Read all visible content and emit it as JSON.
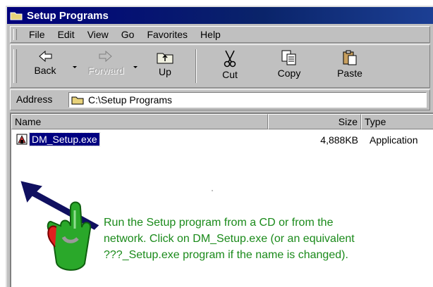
{
  "window": {
    "title": "Setup Programs",
    "title_icon": "folder-icon"
  },
  "menu": [
    {
      "label": "File"
    },
    {
      "label": "Edit"
    },
    {
      "label": "View"
    },
    {
      "label": "Go"
    },
    {
      "label": "Favorites"
    },
    {
      "label": "Help"
    }
  ],
  "toolbar": {
    "back": "Back",
    "forward": "Forward",
    "up": "Up",
    "cut": "Cut",
    "copy": "Copy",
    "paste": "Paste"
  },
  "address": {
    "label": "Address",
    "value": "C:\\Setup Programs"
  },
  "columns": {
    "name": "Name",
    "size": "Size",
    "type": "Type"
  },
  "files": [
    {
      "name": "DM_Setup.exe",
      "size": "4,888KB",
      "type": "Application"
    }
  ],
  "callout": {
    "line1": "Run the Setup program from a CD or from the",
    "line2": "network. Click on DM_Setup.exe (or an equivalent",
    "line3": "???_Setup.exe program if the name is changed)."
  },
  "colors": {
    "callout_text": "#1a8a1a",
    "arrow": "#101060",
    "hand": "#2aa82a",
    "selection": "#000080"
  }
}
